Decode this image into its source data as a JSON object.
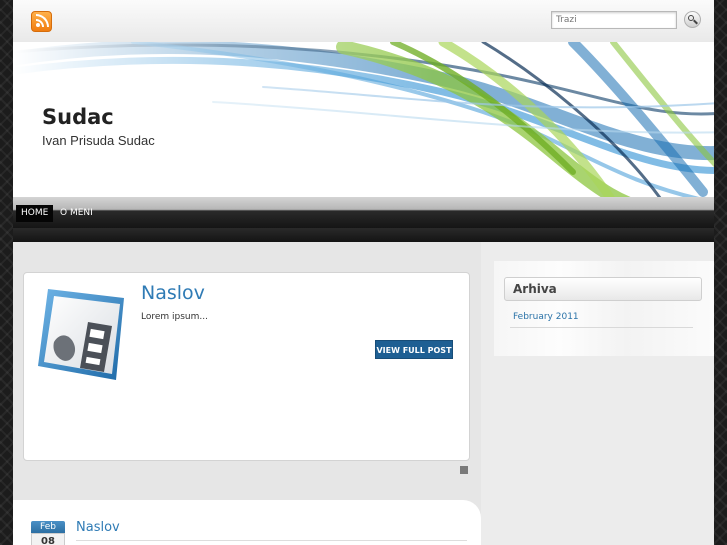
{
  "topbar": {
    "rss_icon": "rss-feed-icon",
    "search_placeholder": "Trazi",
    "search_icon": "magnifier-icon"
  },
  "header": {
    "site_title": "Sudac",
    "site_description": "Ivan Prisuda Sudac",
    "banner_colors": [
      "#1a6fb3",
      "#8cc63f",
      "#0a3a66"
    ]
  },
  "nav": {
    "items": [
      {
        "label": "HOME",
        "active": true
      },
      {
        "label": "O MENI",
        "active": false
      }
    ]
  },
  "featured": {
    "title": "Naslov",
    "excerpt": "Lorem ipsum...",
    "button_label": "VIEW FULL POST",
    "thumb_icon": "image-placeholder-icon"
  },
  "sidebar": {
    "widget_title": "Arhiva",
    "archive_links": [
      "February 2011"
    ]
  },
  "post": {
    "month": "Feb",
    "day": "08",
    "title": "Naslov"
  },
  "colors": {
    "accent": "#2f7bb5",
    "button": "#1e5f93"
  }
}
